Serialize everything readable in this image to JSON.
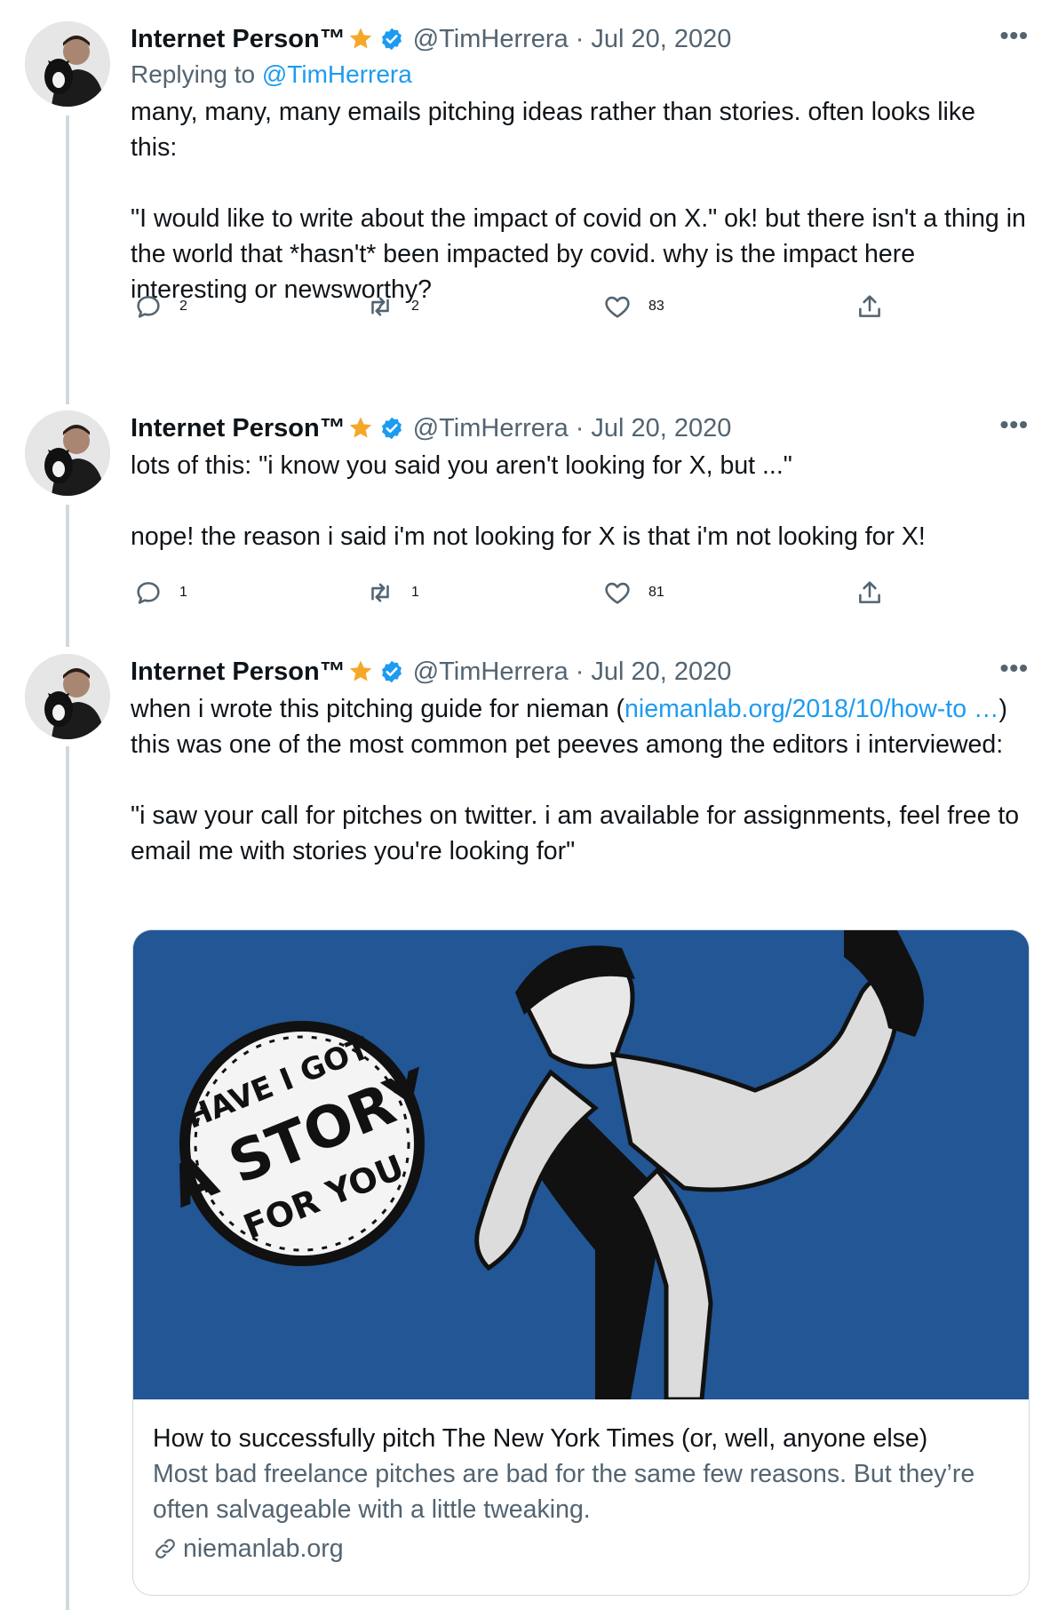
{
  "colors": {
    "accent": "#1d9bf0",
    "star": "#f4a82a",
    "muted": "#536471",
    "thread_line": "#cfd9de",
    "card_bg": "#225695"
  },
  "author": {
    "name": "Internet Person™",
    "handle": "@TimHerrera",
    "date": "Jul 20, 2020",
    "separator": "·"
  },
  "tweets": [
    {
      "more_label": "•••",
      "reply_prefix": "Replying to",
      "reply_handle": "@TimHerrera",
      "paragraphs": [
        "many, many, many emails pitching ideas rather than stories. often looks like this:",
        "\"I would like to write about the impact of covid on X.\" ok! but there isn't a thing in the world that *hasn't* been impacted by covid. why is the impact here interesting or newsworthy?"
      ],
      "reply_count": "2",
      "retweet_count": "2",
      "like_count": "83"
    },
    {
      "more_label": "•••",
      "paragraphs": [
        "lots of this: \"i know you said you aren't looking for X, but ...\"",
        "nope! the reason i said i'm not looking for X is that i'm not looking for X!"
      ],
      "reply_count": "1",
      "retweet_count": "1",
      "like_count": "81"
    },
    {
      "more_label": "•••",
      "text_before_link": "when i wrote this pitching guide for nieman (",
      "link_text": "niemanlab.org/2018/10/how-to …",
      "text_after_link": ") this was one of the most common pet peeves among the editors i interviewed:",
      "paragraph2": "\"i saw your call for pitches on twitter. i am available for assignments, feel free to email me with stories you're looking for\"",
      "card": {
        "image_lines": [
          "HAVE I GOT",
          "A STORY",
          "FOR YOU"
        ],
        "title": "How to successfully pitch The New York Times (or, well, anyone else)",
        "description": "Most bad freelance pitches are bad for the same few reasons. But they’re often salvageable with a little tweaking.",
        "domain": "niemanlab.org"
      }
    }
  ]
}
